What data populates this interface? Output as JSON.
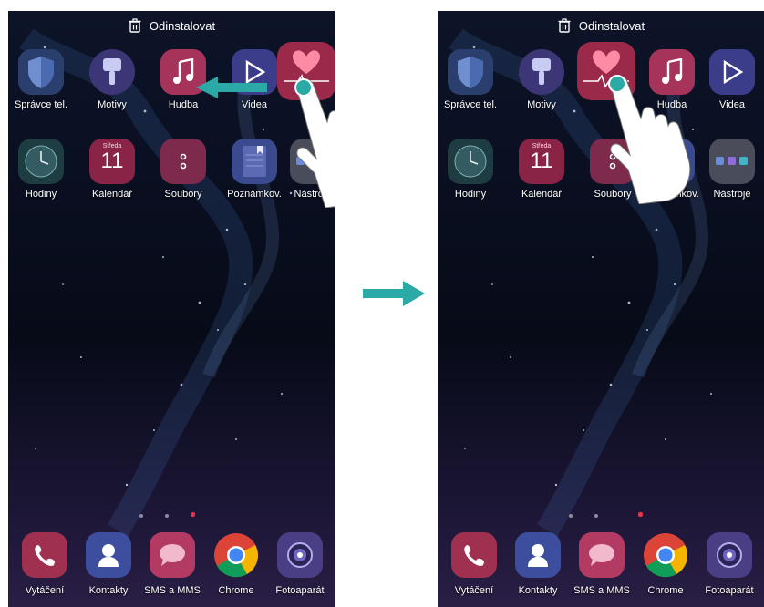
{
  "screens": [
    {
      "uninstall_label": "Odinstalovat",
      "row1": [
        "Správce tel.",
        "Motivy",
        "Hudba",
        "Videa",
        ""
      ],
      "row2": [
        "Hodiny",
        "Kalendář",
        "Soubory",
        "Poznámkov.",
        "Nástroje"
      ],
      "calendar": {
        "day_name": "Středa",
        "day_number": "11"
      }
    },
    {
      "uninstall_label": "Odinstalovat",
      "row1": [
        "Správce tel.",
        "Motivy",
        "",
        "Hudba",
        "Videa"
      ],
      "row2": [
        "Hodiny",
        "Kalendář",
        "Soubory",
        "Poznámkov.",
        "Nástroje"
      ],
      "calendar": {
        "day_name": "Středa",
        "day_number": "11"
      }
    }
  ],
  "dock": [
    "Vytáčení",
    "Kontakty",
    "SMS a MMS",
    "Chrome",
    "Fotoaparát"
  ],
  "colors": {
    "accent_arrow": "#2aa9a6",
    "page_dot_active": "#e0364a",
    "health_app": "#9b2a4a"
  }
}
